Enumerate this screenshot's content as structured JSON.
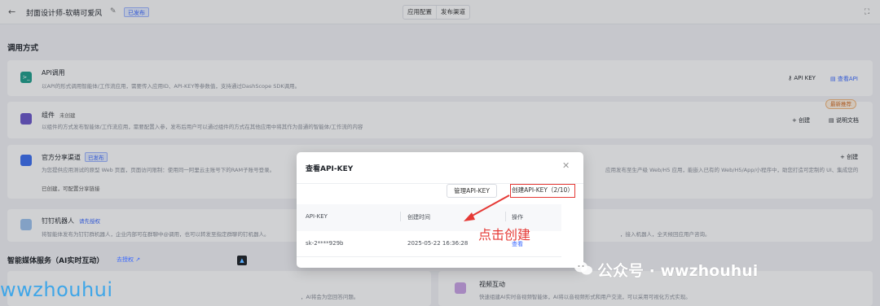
{
  "topbar": {
    "title": "封面设计师-软萌可爱风",
    "status_badge": "已发布",
    "tabs": [
      "应用配置",
      "发布渠道"
    ]
  },
  "section_title": "调用方式",
  "cards": {
    "api": {
      "title": "API调用",
      "desc": "以API的形式调用智能体/工作流应用，需要传入应用ID、API-KEY等参数值，支持通过DashScope SDK调用。",
      "actions": [
        "API KEY",
        "查看API"
      ]
    },
    "component": {
      "title": "组件",
      "tag": "未创建",
      "desc": "以组件的方式发布智能体/工作流应用，需要配置入参，发布后用户可以通过组件的方式在其他应用中将其作为普通的智能体/工作流的内容",
      "recommend_badge": "最新推荐",
      "actions": [
        "创建",
        "说明文档"
      ]
    },
    "official": {
      "title": "官方分享渠道",
      "tag": "已发布",
      "desc_left": "为您提供应用测试的原型 Web 页面，页面访问限制：使用同一阿里云主账号下的RAM子账号登录。",
      "desc_right": "应用发布至生产级 Web/H5 应用，能嵌入已有的 Web/H5/App/小程序中，助您打造可定制的 UI、集成您的",
      "note": "已创建，可配置分享链接",
      "action": "创建"
    },
    "dingtalk": {
      "title": "钉钉机器人",
      "link": "请先授权",
      "desc": "将智能体发布为钉钉群机器人，企业内部可在群聊中@调用，也可以转发至指定群聊的钉机器人。",
      "desc_right": "，接入机器人，全天候回应用户咨询。"
    },
    "media": {
      "title": "视频互动",
      "desc": "快速组建AI实时音视频智能体，AI将以音视频形式和用户交流，可以采用可视化方式实现。",
      "desc_left": "，AI将会为您回答问题。"
    }
  },
  "sub_section": {
    "title": "智能媒体服务（AI实时互动）",
    "link": "去授权"
  },
  "modal": {
    "title": "查看API-KEY",
    "manage_button": "管理API-KEY",
    "create_button": "创建API-KEY（2/10）",
    "columns": [
      "API-KEY",
      "创建时间",
      "操作"
    ],
    "rows": [
      {
        "key": "sk-2****929b",
        "created": "2025-05-22 16:36:28",
        "action": "查看"
      }
    ]
  },
  "annotation": "点击创建",
  "watermarks": {
    "left": "wwzhouhui",
    "right": "公众号 · wwzhouhui"
  },
  "colors": {
    "accent": "#3867ff",
    "annotation_red": "#e53935",
    "watermark_blue": "#3fa6e8"
  }
}
